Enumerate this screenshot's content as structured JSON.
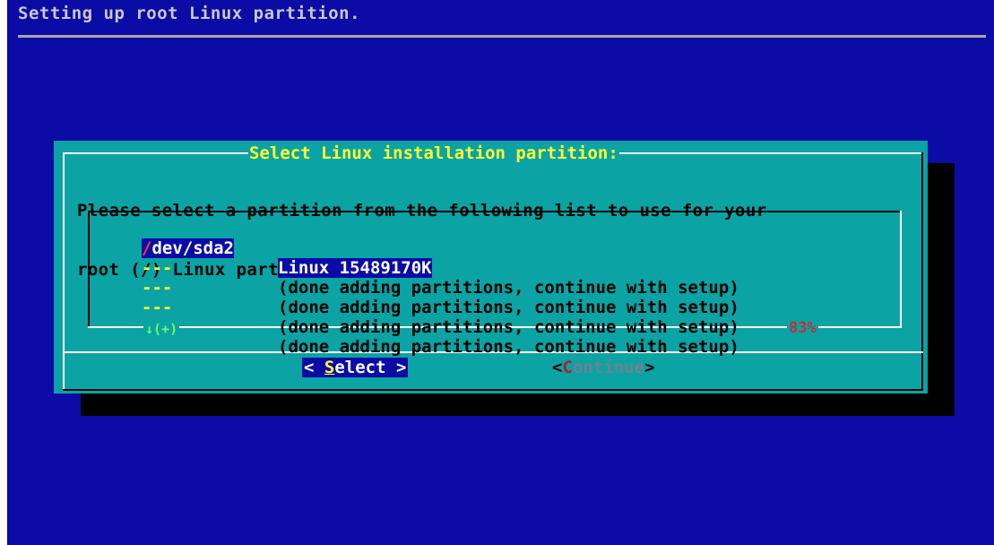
{
  "backtitle": "Setting up root Linux partition.",
  "dialog": {
    "title": "Select Linux installation partition:",
    "prompt_line1": "Please select a partition from the following list to use for your",
    "prompt_line2": "root (/) Linux partition."
  },
  "menu": {
    "items": [
      {
        "tag_first": "/",
        "tag_rest": "dev/sda2",
        "item": "Linux 15489170K",
        "selected": true
      },
      {
        "tag": "---",
        "item": "(done adding partitions, continue with setup)"
      },
      {
        "tag": "---",
        "item": "(done adding partitions, continue with setup)"
      },
      {
        "tag": "---",
        "item": "(done adding partitions, continue with setup)"
      },
      {
        "tag": "---",
        "item": "(done adding partitions, continue with setup)"
      }
    ],
    "scroll_indicator": "↓(+)",
    "scroll_percent": "83%"
  },
  "buttons": {
    "select": {
      "open": "< ",
      "hotkey": "S",
      "rest": "elect",
      "close": " >"
    },
    "continue": {
      "open": "<",
      "hotkey": "C",
      "rest": "ontinue",
      "close": ">"
    }
  },
  "colors": {
    "background": "#0b0ba6",
    "dialog": "#0ba3a3",
    "title": "#ffff33",
    "scroll_indicator": "#66ff66",
    "percent": "#c0303a"
  }
}
